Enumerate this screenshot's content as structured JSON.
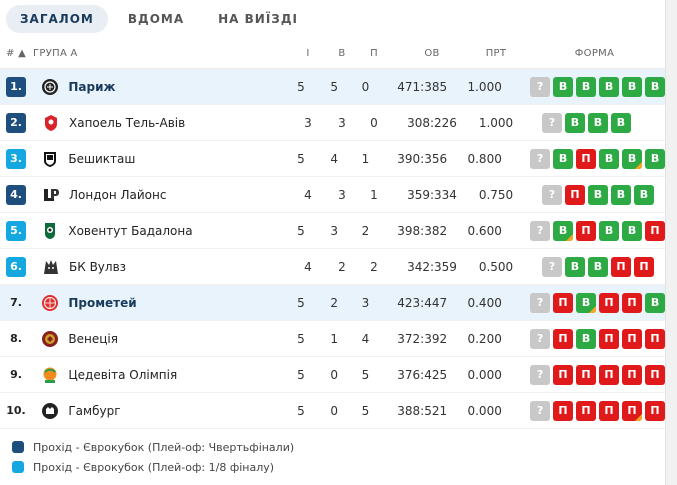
{
  "tabs": [
    "ЗАГАЛОМ",
    "ВДОМА",
    "НА ВИЇЗДІ"
  ],
  "header": {
    "pos": "# ▲",
    "group": "ГРУПА A",
    "played": "І",
    "won": "В",
    "lost": "П",
    "points": "ОВ",
    "ratio": "ПРТ",
    "form": "ФОРМА"
  },
  "rows": [
    {
      "pos": "1.",
      "name": "Париж",
      "played": "5",
      "won": "5",
      "lost": "0",
      "points": "471:385",
      "ratio": "1.000",
      "qual": "dark",
      "highlight": true,
      "form": [
        "?",
        "В",
        "В",
        "В",
        "В",
        "В"
      ],
      "logo": "paris-logo"
    },
    {
      "pos": "2.",
      "name": "Хапоель Тель-Авів",
      "played": "3",
      "won": "3",
      "lost": "0",
      "points": "308:226",
      "ratio": "1.000",
      "qual": "dark",
      "highlight": false,
      "form": [
        "?",
        "В",
        "В",
        "В"
      ],
      "logo": "hapoel-logo"
    },
    {
      "pos": "3.",
      "name": "Бешикташ",
      "played": "5",
      "won": "4",
      "lost": "1",
      "points": "390:356",
      "ratio": "0.800",
      "qual": "light",
      "highlight": false,
      "form": [
        "?",
        "В",
        "П",
        "В",
        "В",
        "В"
      ],
      "logo": "besiktas-logo"
    },
    {
      "pos": "4.",
      "name": "Лондон Лайонс",
      "played": "4",
      "won": "3",
      "lost": "1",
      "points": "359:334",
      "ratio": "0.750",
      "qual": "dark",
      "highlight": false,
      "form": [
        "?",
        "П",
        "В",
        "В",
        "В"
      ],
      "logo": "london-lions-logo"
    },
    {
      "pos": "5.",
      "name": "Ховентут Бадалона",
      "played": "5",
      "won": "3",
      "lost": "2",
      "points": "398:382",
      "ratio": "0.600",
      "qual": "light",
      "highlight": false,
      "form": [
        "?",
        "В",
        "П",
        "В",
        "В",
        "П"
      ],
      "logo": "joventut-logo"
    },
    {
      "pos": "6.",
      "name": "БК Вулвз",
      "played": "4",
      "won": "2",
      "lost": "2",
      "points": "342:359",
      "ratio": "0.500",
      "qual": "light",
      "highlight": false,
      "form": [
        "?",
        "В",
        "В",
        "П",
        "П"
      ],
      "logo": "wolves-logo"
    },
    {
      "pos": "7.",
      "name": "Прометей",
      "played": "5",
      "won": "2",
      "lost": "3",
      "points": "423:447",
      "ratio": "0.400",
      "qual": "none",
      "highlight": true,
      "form": [
        "?",
        "П",
        "В",
        "П",
        "П",
        "В"
      ],
      "logo": "prometey-logo"
    },
    {
      "pos": "8.",
      "name": "Венеція",
      "played": "5",
      "won": "1",
      "lost": "4",
      "points": "372:392",
      "ratio": "0.200",
      "qual": "none",
      "highlight": false,
      "form": [
        "?",
        "П",
        "В",
        "П",
        "П",
        "П"
      ],
      "logo": "venezia-logo"
    },
    {
      "pos": "9.",
      "name": "Цедевіта Олімпія",
      "played": "5",
      "won": "0",
      "lost": "5",
      "points": "376:425",
      "ratio": "0.000",
      "qual": "none",
      "highlight": false,
      "form": [
        "?",
        "П",
        "П",
        "П",
        "П",
        "П"
      ],
      "logo": "cedevita-logo"
    },
    {
      "pos": "10.",
      "name": "Гамбург",
      "played": "5",
      "won": "0",
      "lost": "5",
      "points": "388:521",
      "ratio": "0.000",
      "qual": "none",
      "highlight": false,
      "form": [
        "?",
        "П",
        "П",
        "П",
        "П",
        "П"
      ],
      "logo": "hamburg-logo"
    }
  ],
  "form_marks": {
    "2": [
      4
    ],
    "4": [
      1
    ],
    "6": [
      2
    ],
    "7": [],
    "8": [],
    "9": [
      4
    ],
    "1": [],
    "0": [],
    "3": [],
    "5": []
  },
  "legend": [
    {
      "label": "Прохід - Єврокубок (Плей-оф: Чвертьфінали)",
      "color": "#1e4e7e"
    },
    {
      "label": "Прохід - Єврокубок (Плей-оф: 1/8 фіналу)",
      "color": "#15a8e0"
    }
  ],
  "colors": {
    "win": "#2eaa44",
    "loss": "#e01a1a",
    "unknown": "#c8c8c8",
    "highlight_row": "#e8f3fb"
  }
}
